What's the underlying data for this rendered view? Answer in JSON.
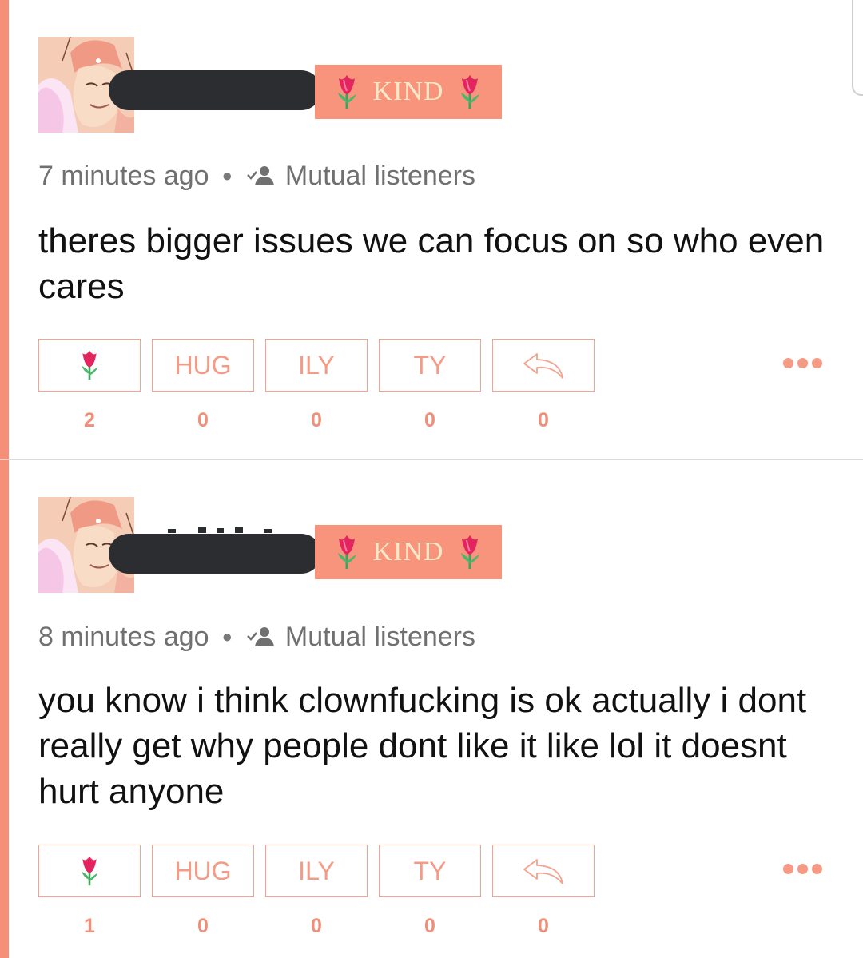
{
  "badge_label": "KIND",
  "accent_color": "#f8937c",
  "posts": [
    {
      "time": "7 minutes ago",
      "audience": "Mutual listeners",
      "text": "theres bigger issues we can focus on so who even cares",
      "reactions": [
        {
          "label": "",
          "icon": "tulip-icon",
          "count": "2"
        },
        {
          "label": "HUG",
          "count": "0"
        },
        {
          "label": "ILY",
          "count": "0"
        },
        {
          "label": "TY",
          "count": "0"
        },
        {
          "label": "",
          "icon": "reply-icon",
          "count": "0"
        }
      ]
    },
    {
      "time": "8 minutes ago",
      "audience": "Mutual listeners",
      "text": "you know i think clownfucking is ok actually i dont really get why people dont like it like lol it doesnt hurt anyone",
      "reactions": [
        {
          "label": "",
          "icon": "tulip-icon",
          "count": "1"
        },
        {
          "label": "HUG",
          "count": "0"
        },
        {
          "label": "ILY",
          "count": "0"
        },
        {
          "label": "TY",
          "count": "0"
        },
        {
          "label": "",
          "icon": "reply-icon",
          "count": "0"
        }
      ]
    }
  ]
}
